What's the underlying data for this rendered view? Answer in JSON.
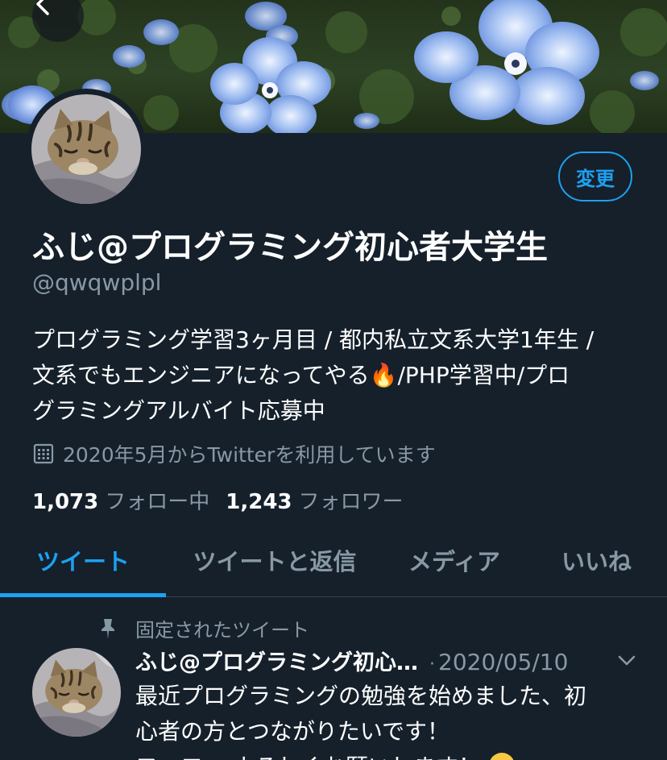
{
  "profile": {
    "display_name": "ふじ@プログラミング初心者大学生",
    "handle": "@qwqwplpl",
    "bio_line1": "プログラミング学習3ヶ月目 / 都内私立文系大学1年生 /",
    "bio_line2_before": "文系でもエンジニアになってやる",
    "bio_emoji": "🔥",
    "bio_line2_after": "/PHP学習中/プロ",
    "bio_line3": "グラミングアルバイト応募中",
    "joined": "2020年5月からTwitterを利用しています",
    "following_count": "1,073",
    "following_label": "フォロー中",
    "followers_count": "1,243",
    "followers_label": "フォロワー",
    "edit_button_label": "変更"
  },
  "icons": {
    "back": "chevron-left-icon",
    "calendar": "calendar-icon",
    "pin": "pin-icon",
    "more": "chevron-down-icon",
    "emoji": "fire-emoji",
    "tweet_emoji": "grinning-face-emoji"
  },
  "tabs": [
    {
      "label": "ツイート",
      "active": true
    },
    {
      "label": "ツイートと返信",
      "active": false
    },
    {
      "label": "メディア",
      "active": false
    },
    {
      "label": "いいね",
      "active": false
    }
  ],
  "pinned_tweet": {
    "pinned_label": "固定されたツイート",
    "author_name": "ふじ@プログラミング初心…",
    "separator": "·",
    "date": "2020/05/10",
    "text_line1": "最近プログラミングの勉強を始めました、初",
    "text_line2": "心者の方とつながりたいです！",
    "text_line3": "フォロー よろしくお願いします！"
  },
  "colors": {
    "background": "#15202b",
    "accent": "#1da1f2",
    "secondary_text": "#8899a6",
    "divider": "#38444d"
  }
}
